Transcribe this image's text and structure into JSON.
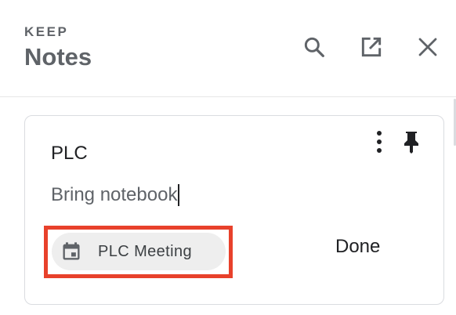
{
  "header": {
    "app_label": "KEEP",
    "title": "Notes",
    "icons": [
      "search-icon",
      "open-in-new-icon",
      "close-icon"
    ]
  },
  "note": {
    "title": "PLC",
    "body": "Bring notebook",
    "icons": [
      "more-vert-icon",
      "pin-icon"
    ],
    "chip": {
      "icon": "calendar-icon",
      "label": "PLC Meeting"
    },
    "done_label": "Done"
  },
  "colors": {
    "highlight": "#e8412b",
    "chip_background": "#eeeeee",
    "text_secondary": "#5f6368"
  }
}
